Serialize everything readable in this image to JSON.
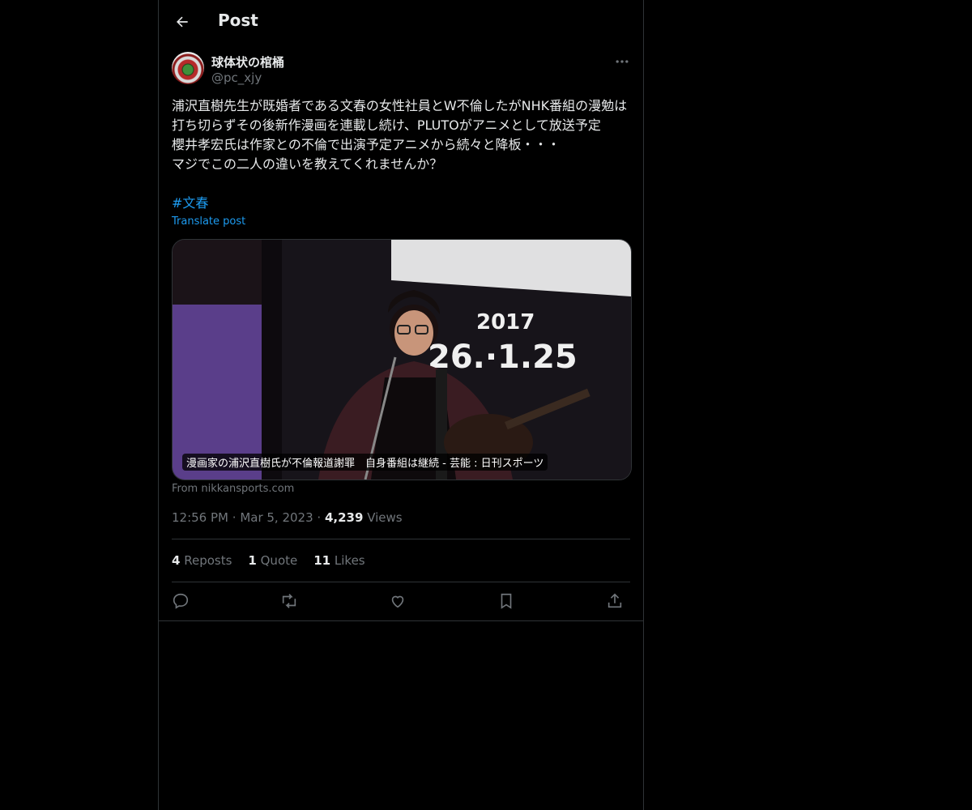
{
  "header": {
    "title": "Post"
  },
  "author": {
    "name": "球体状の棺桶",
    "handle": "@pc_xjy"
  },
  "post": {
    "text": "浦沢直樹先生が既婚者である文春の女性社員とW不倫したがNHK番組の漫勉は打ち切らずその後新作漫画を連載し続け、PLUTOがアニメとして放送予定\n櫻井孝宏氏は作家との不倫で出演予定アニメから続々と降板・・・\nマジでこの二人の違いを教えてくれませんか？",
    "hashtag": "#文春",
    "translate_label": "Translate post"
  },
  "link_card": {
    "caption": "漫画家の浦沢直樹氏が不倫報道謝罪　自身番組は継続 - 芸能 : 日刊スポーツ",
    "from": "From nikkansports.com",
    "image_text": {
      "year": "2017",
      "dates": "26.·1.25"
    }
  },
  "meta": {
    "time": "12:56 PM",
    "date": "Mar 5, 2023",
    "views_count": "4,239",
    "views_label": "Views"
  },
  "stats": [
    {
      "count": "4",
      "label": "Reposts"
    },
    {
      "count": "1",
      "label": "Quote"
    },
    {
      "count": "11",
      "label": "Likes"
    }
  ],
  "icons": [
    "back-arrow-icon",
    "more-icon",
    "reply-icon",
    "repost-icon",
    "like-icon",
    "bookmark-icon",
    "share-icon"
  ]
}
